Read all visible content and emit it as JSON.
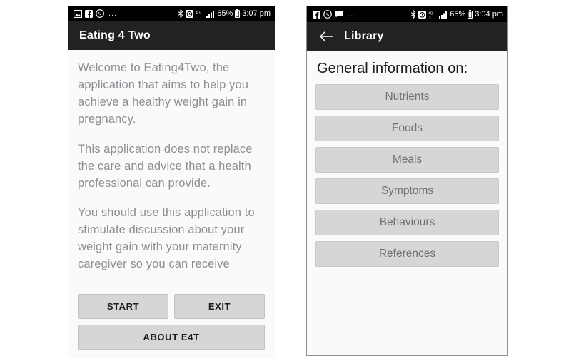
{
  "left_phone": {
    "status_bar": {
      "icons": [
        "photo-icon",
        "facebook-icon",
        "whatsapp-icon"
      ],
      "overflow": "...",
      "right_icons": [
        "bluetooth-icon",
        "alarm-icon"
      ],
      "network": "4G",
      "signal": "signal-bars-icon",
      "battery_percent": "65%",
      "battery": "battery-icon",
      "time": "3:07 pm"
    },
    "app_bar": {
      "title": "Eating 4 Two"
    },
    "paragraphs": [
      "Welcome to Eating4Two, the application that aims to help you achieve a healthy weight gain in pregnancy.",
      "This application does not replace the care and advice that a health professional can provide.",
      "You should use this application to stimulate discussion about your weight gain with your maternity caregiver so you can receive"
    ],
    "buttons": {
      "start": "START",
      "exit": "EXIT",
      "about": "ABOUT E4T"
    }
  },
  "right_phone": {
    "status_bar": {
      "icons": [
        "facebook-icon",
        "whatsapp-icon",
        "message-icon"
      ],
      "overflow": "...",
      "right_icons": [
        "bluetooth-icon",
        "alarm-icon"
      ],
      "network": "4G",
      "signal": "signal-bars-icon",
      "battery_percent": "65%",
      "battery": "battery-icon",
      "time": "3:04 pm"
    },
    "app_bar": {
      "back": "back-arrow-icon",
      "title": "Library"
    },
    "heading": "General information on:",
    "library_items": [
      "Nutrients",
      "Foods",
      "Meals",
      "Symptoms",
      "Behaviours",
      "References"
    ]
  },
  "colors": {
    "status_bar_bg": "#000000",
    "app_bar_bg": "#222222",
    "button_bg": "#d6d6d6",
    "body_bg": "#fafafa",
    "body_text": "#8b8f93"
  }
}
